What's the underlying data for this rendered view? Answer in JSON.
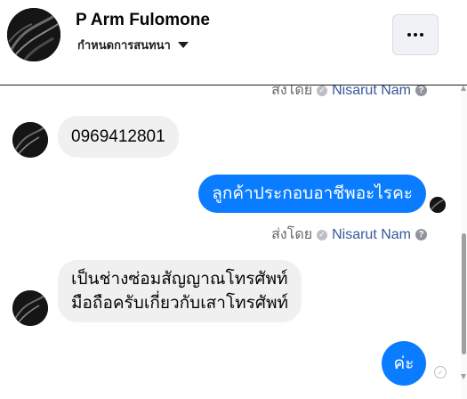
{
  "header": {
    "contact_name": "P Arm Fulomone",
    "conversation_settings": "กำหนดการสนทนา",
    "more_icon": "ellipsis-icon"
  },
  "messages": [
    {
      "direction": "out",
      "type": "sent-by",
      "prefix": "ส่งโดย",
      "sender": "Nisarut Nam"
    },
    {
      "direction": "in",
      "text": "0969412801"
    },
    {
      "direction": "out",
      "text": "ลูกค้าประกอบอาชีพอะไรคะ"
    },
    {
      "direction": "out",
      "type": "sent-by",
      "prefix": "ส่งโดย",
      "sender": "Nisarut Nam"
    },
    {
      "direction": "in",
      "lines": [
        "เป็นช่างซ่อมสัญญาณโทรศัพท์",
        "มือถือครับเกี่ยวกับเสาโทรศัพท์"
      ]
    },
    {
      "direction": "out",
      "text": "ค่ะ"
    }
  ],
  "colors": {
    "outgoing_bubble": "#0a7cff",
    "incoming_bubble": "#f0f0f0",
    "sender_link": "#385898",
    "meta_text": "#65676b"
  }
}
